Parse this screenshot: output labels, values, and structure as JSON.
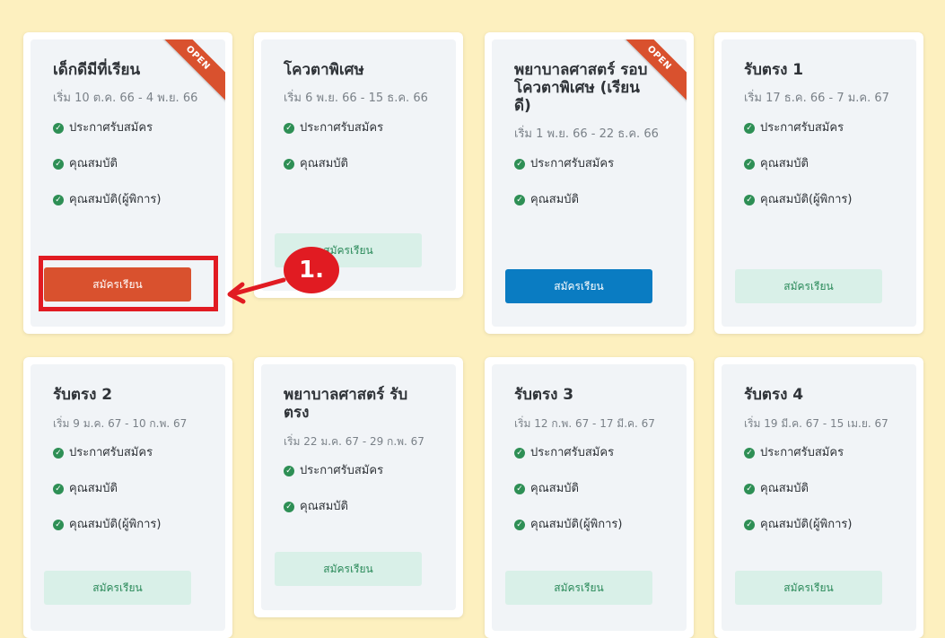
{
  "cards": [
    {
      "title": "เด็กดีมีที่เรียน",
      "date": "เริ่ม 10 ต.ค. 66 - 4 พ.ย. 66",
      "items": [
        "ประกาศรับสมัคร",
        "คุณสมบัติ",
        "คุณสมบัติ(ผู้พิการ)"
      ],
      "button": "สมัครเรียน",
      "ribbon": "OPEN"
    },
    {
      "title": "โควตาพิเศษ",
      "date": "เริ่ม 6 พ.ย. 66 - 15 ธ.ค. 66",
      "items": [
        "ประกาศรับสมัคร",
        "คุณสมบัติ"
      ],
      "button": "สมัครเรียน"
    },
    {
      "title": "พยาบาลศาสตร์ รอบโควตาพิเศษ (เรียนดี)",
      "date": "เริ่ม 1 พ.ย. 66 - 22 ธ.ค. 66",
      "items": [
        "ประกาศรับสมัคร",
        "คุณสมบัติ"
      ],
      "button": "สมัครเรียน",
      "ribbon": "OPEN"
    },
    {
      "title": "รับตรง 1",
      "date": "เริ่ม 17 ธ.ค. 66 - 7 ม.ค. 67",
      "items": [
        "ประกาศรับสมัคร",
        "คุณสมบัติ",
        "คุณสมบัติ(ผู้พิการ)"
      ],
      "button": "สมัครเรียน"
    },
    {
      "title": "รับตรง 2",
      "date": "เริ่ม 9 ม.ค. 67 - 10 ก.พ. 67",
      "items": [
        "ประกาศรับสมัคร",
        "คุณสมบัติ",
        "คุณสมบัติ(ผู้พิการ)"
      ],
      "button": "สมัครเรียน"
    },
    {
      "title": "พยาบาลศาสตร์ รับตรง",
      "date": "เริ่ม 22 ม.ค. 67 - 29 ก.พ. 67",
      "items": [
        "ประกาศรับสมัคร",
        "คุณสมบัติ"
      ],
      "button": "สมัครเรียน"
    },
    {
      "title": "รับตรง 3",
      "date": "เริ่ม 12 ก.พ. 67 - 17 มี.ค. 67",
      "items": [
        "ประกาศรับสมัคร",
        "คุณสมบัติ",
        "คุณสมบัติ(ผู้พิการ)"
      ],
      "button": "สมัครเรียน"
    },
    {
      "title": "รับตรง 4",
      "date": "เริ่ม 19 มี.ค. 67 - 15 เม.ย. 67",
      "items": [
        "ประกาศรับสมัคร",
        "คุณสมบัติ",
        "คุณสมบัติ(ผู้พิการ)"
      ],
      "button": "สมัครเรียน"
    }
  ],
  "annotation": {
    "step": "1."
  },
  "colors": {
    "background": "#fdf0bf",
    "accent_red": "#d9512e",
    "accent_blue": "#0a7cc2",
    "button_green_bg": "#d9f0e8",
    "check_green": "#2e8f55",
    "highlight": "#e11b22"
  }
}
